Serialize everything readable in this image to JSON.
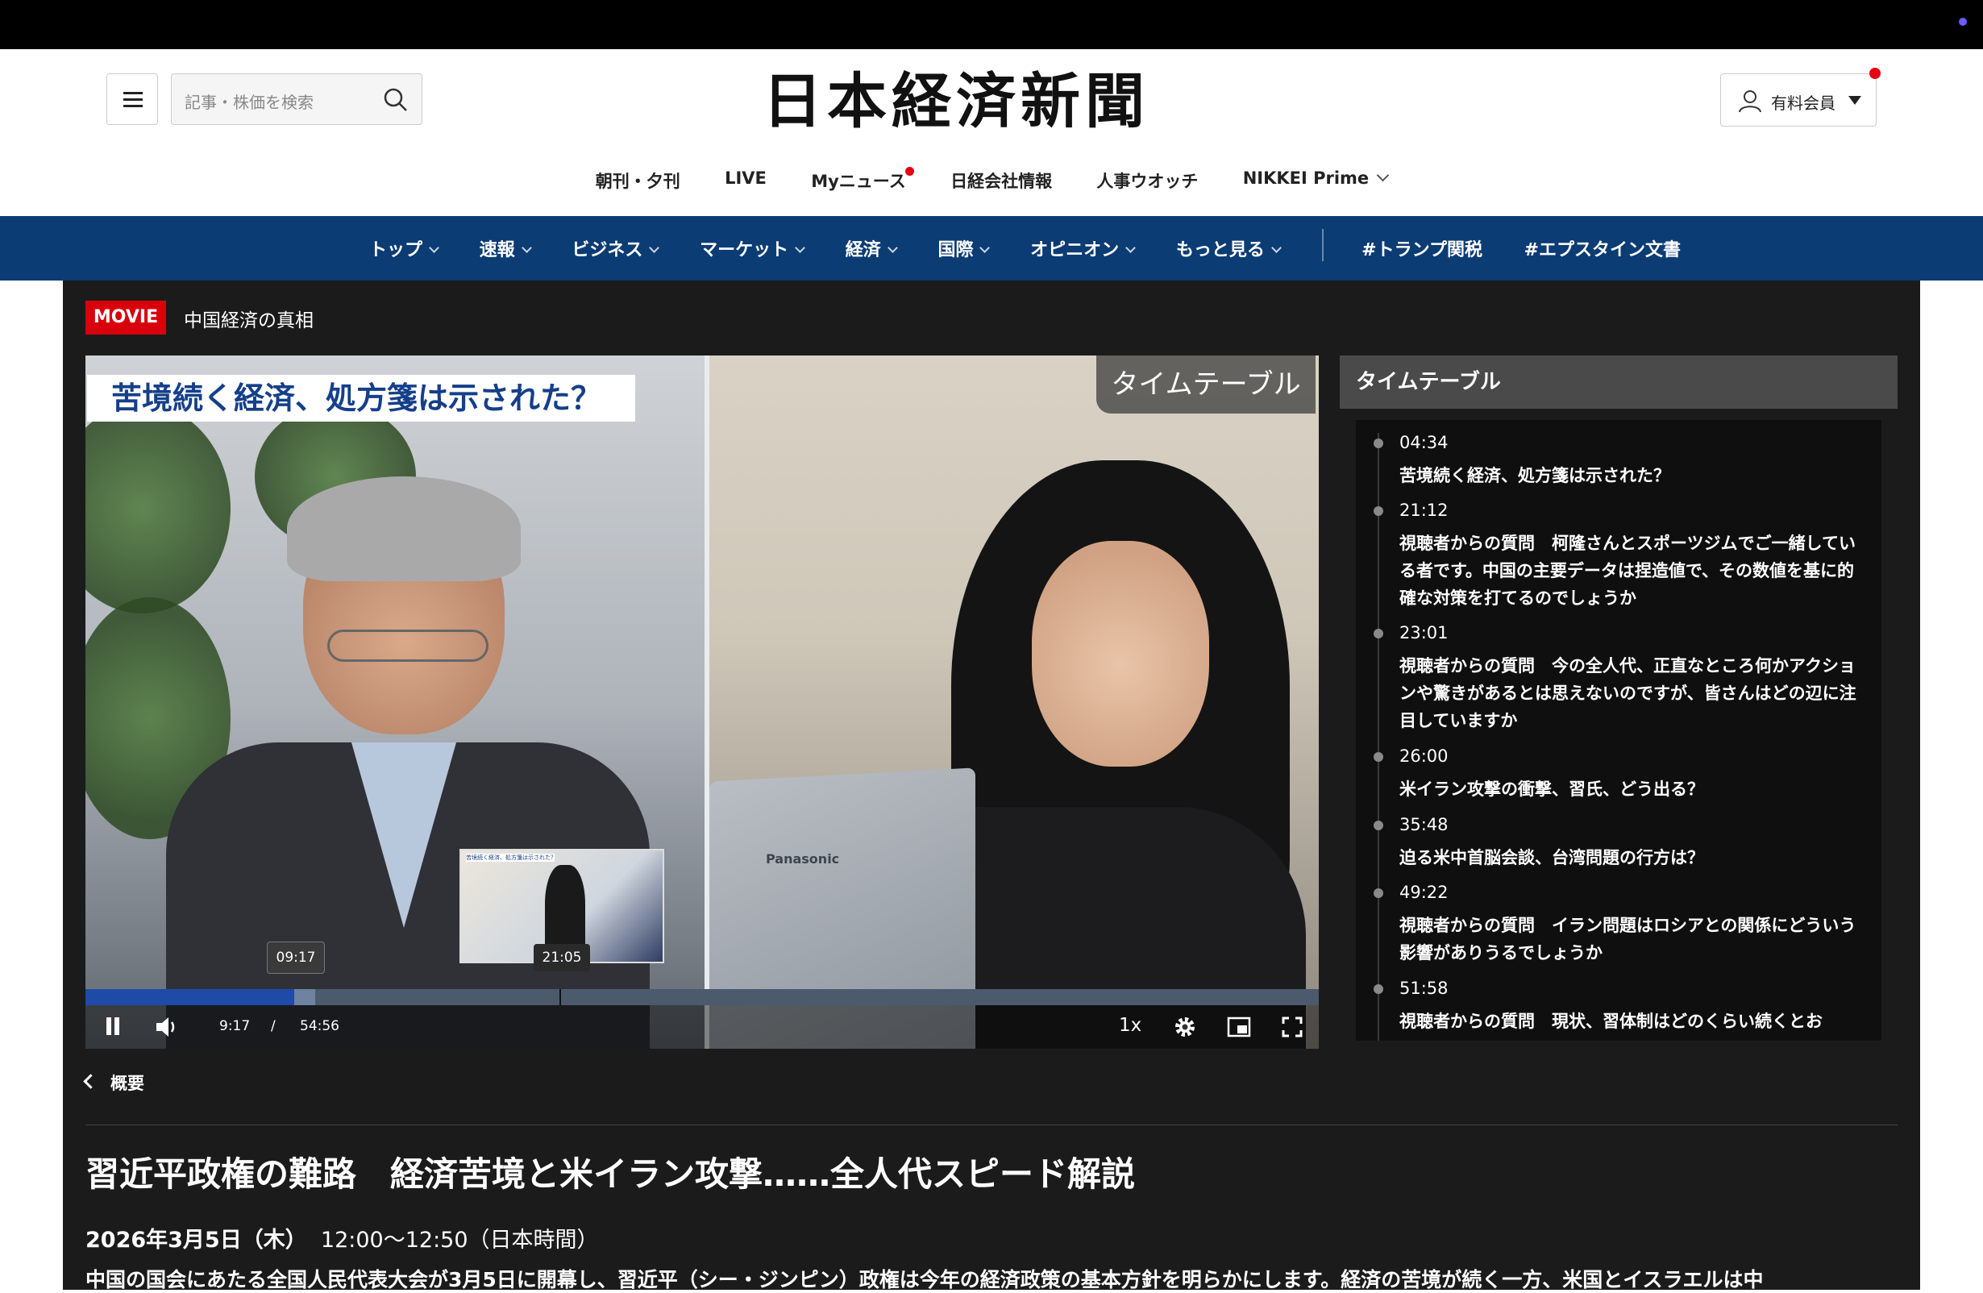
{
  "header": {
    "search_placeholder": "記事・株価を検索",
    "logo": "日本経済新聞",
    "member_label": "有料会員"
  },
  "subnav": [
    {
      "label": "朝刊・夕刊"
    },
    {
      "label": "LIVE"
    },
    {
      "label": "Myニュース"
    },
    {
      "label": "日経会社情報"
    },
    {
      "label": "人事ウオッチ"
    },
    {
      "label": "NIKKEI Prime"
    }
  ],
  "mainnav": [
    {
      "label": "トップ"
    },
    {
      "label": "速報"
    },
    {
      "label": "ビジネス"
    },
    {
      "label": "マーケット"
    },
    {
      "label": "経済"
    },
    {
      "label": "国際"
    },
    {
      "label": "オピニオン"
    },
    {
      "label": "もっと見る"
    },
    {
      "label": "#トランプ関税"
    },
    {
      "label": "#エプスタイン文書"
    }
  ],
  "movie": {
    "badge": "MOVIE",
    "series": "中国経済の真相"
  },
  "video": {
    "headline": "苦境続く経済、処方箋は示された？",
    "timetable_overlay": "タイムテーブル",
    "laptop_brand": "Panasonic",
    "preview_title": "苦境続く経済、処方箋は示された？",
    "hover_tip": "09:17",
    "preview_time": "21:05",
    "current_time": "9:17",
    "separator": "/",
    "duration": "54:56",
    "speed": "1x",
    "played_fraction": 0.169,
    "buffered_fraction": 0.186,
    "hover_fraction": 0.384
  },
  "timetable": {
    "title": "タイムテーブル",
    "entries": [
      {
        "time": "04:34",
        "title": "苦境続く経済、処方箋は示された？"
      },
      {
        "time": "21:12",
        "title": "視聴者からの質問　柯隆さんとスポーツジムでご一緒している者です。中国の主要データは捏造値で、その数値を基に的確な対策を打てるのでしょうか"
      },
      {
        "time": "23:01",
        "title": "視聴者からの質問　今の全人代、正直なところ何かアクションや驚きがあるとは思えないのですが、皆さんはどの辺に注目していますか"
      },
      {
        "time": "26:00",
        "title": "米イラン攻撃の衝撃、習氏、どう出る？"
      },
      {
        "time": "35:48",
        "title": "迫る米中首脳会談、台湾問題の行方は？"
      },
      {
        "time": "49:22",
        "title": "視聴者からの質問　イラン問題はロシアとの関係にどういう影響がありうるでしょうか"
      },
      {
        "time": "51:58",
        "title": "視聴者からの質問　現状、習体制はどのくらい続くとお"
      }
    ]
  },
  "article": {
    "back_label": "概要",
    "title": "習近平政権の難路　経済苦境と米イラン攻撃……全人代スピード解説",
    "date_bold": "2026年3月5日（木）",
    "time": "12:00～12:50（日本時間）",
    "description": "中国の国会にあたる全国人民代表大会が3月5日に開幕し、習近平（シー・ジンピン）政権は今年の経済政策の基本方針を明らかにします。経済の苦境が続く一方、米国とイスラエルは中"
  },
  "colors": {
    "nav_blue": "#0c3c74",
    "movie_red": "#d9000d",
    "progress_played": "#1e4aa8"
  }
}
